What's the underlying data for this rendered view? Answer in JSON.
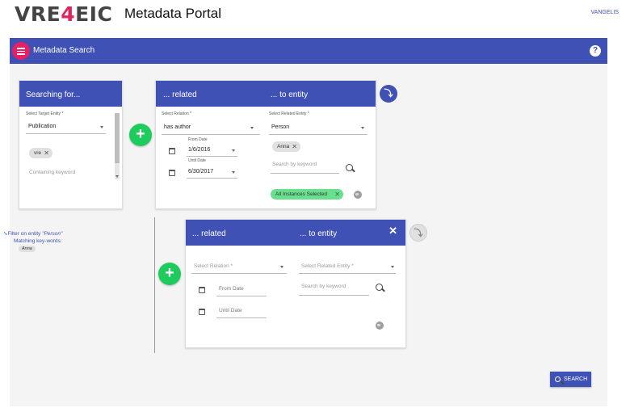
{
  "header": {
    "logo_pre": "VRE",
    "logo_mid": "4",
    "logo_post": "EIC",
    "title": "Metadata Portal",
    "user": "VANGELIS"
  },
  "appbar": {
    "title": "Metadata Search",
    "help_icon": "help-circle-icon"
  },
  "target_card": {
    "header": "Searching for...",
    "entity_label": "Select Target Entity *",
    "entity_value": "Publication",
    "chips": [
      "vre"
    ],
    "keyword_placeholder": "Containing keyword"
  },
  "related_card_1": {
    "header_related": "... related",
    "header_entity": "... to entity",
    "relation_label": "Select Relation *",
    "relation_value": "has author",
    "from_label": "From Date",
    "from_value": "1/6/2016",
    "until_label": "Until Date",
    "until_value": "6/30/2017",
    "entity_label": "Select Related Entity *",
    "entity_value": "Person",
    "chips": [
      "Anna"
    ],
    "keyword_placeholder": "Search by keyword",
    "all_instances_chip": "All Instances Selected"
  },
  "related_card_2": {
    "header_related": "... related",
    "header_entity": "... to entity",
    "relation_placeholder": "Select Relation *",
    "entity_placeholder": "Select Related Entity *",
    "from_placeholder": "From Date",
    "until_placeholder": "Until Date",
    "keyword_placeholder": "Search by keyword"
  },
  "filter": {
    "prefix": "Filter on entity ",
    "entity": "\"Person\"",
    "matching": "Matching key-words:",
    "keywords": [
      "Anna"
    ]
  },
  "add_label": "+",
  "search_button": "SEARCH",
  "colors": {
    "primary": "#3f51b5",
    "accent": "#e91e63",
    "add_green": "#1ecc5e",
    "selected_chip": "#69e08e"
  }
}
